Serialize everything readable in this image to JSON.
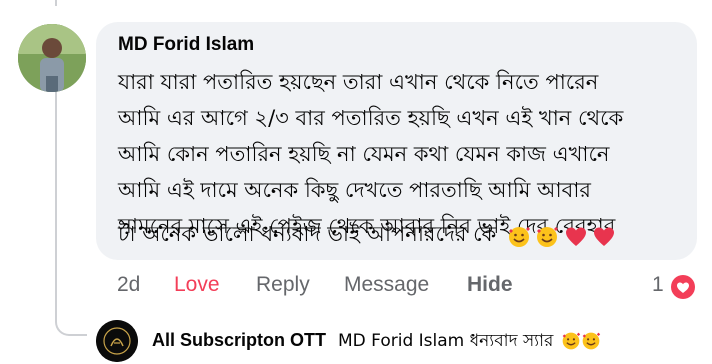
{
  "comment": {
    "author": "MD Forid Islam",
    "lines": [
      "যারা যারা পতারিত হয়ছেন তারা এখান থেকে নিতে পারেন",
      "আমি এর আগে ২/৩ বার পতারিত হয়ছি এখন এই খান থেকে",
      "আমি কোন পতারিন হয়ছি না যেমন কথা যেমন কাজ এখানে",
      "আমি এই দামে অনেক কিছু দেখতে পারতাছি আমি আবার",
      "সামনের মাসে এই পেইজ থেকে আবার নিব ভাই দের বেবহার",
      "টা অনেক ভালো ধন্যবাদ ভাই আপনারদের কে"
    ],
    "trailing_emojis": [
      "smiling-face-with-hearts",
      "smiling-face-with-hearts",
      "red-heart",
      "red-heart"
    ]
  },
  "actions": {
    "time": "2d",
    "love": "Love",
    "reply": "Reply",
    "message": "Message",
    "hide": "Hide"
  },
  "reactions": {
    "count": "1",
    "type": "love-reaction-icon",
    "color": "#f33e58"
  },
  "reply": {
    "author": "All Subscripton OTT",
    "text": "MD Forid Islam ধন্যবাদ স্যার",
    "trailing_emojis": [
      "smiling-face-with-hearts",
      "smiling-face-with-hearts"
    ]
  }
}
